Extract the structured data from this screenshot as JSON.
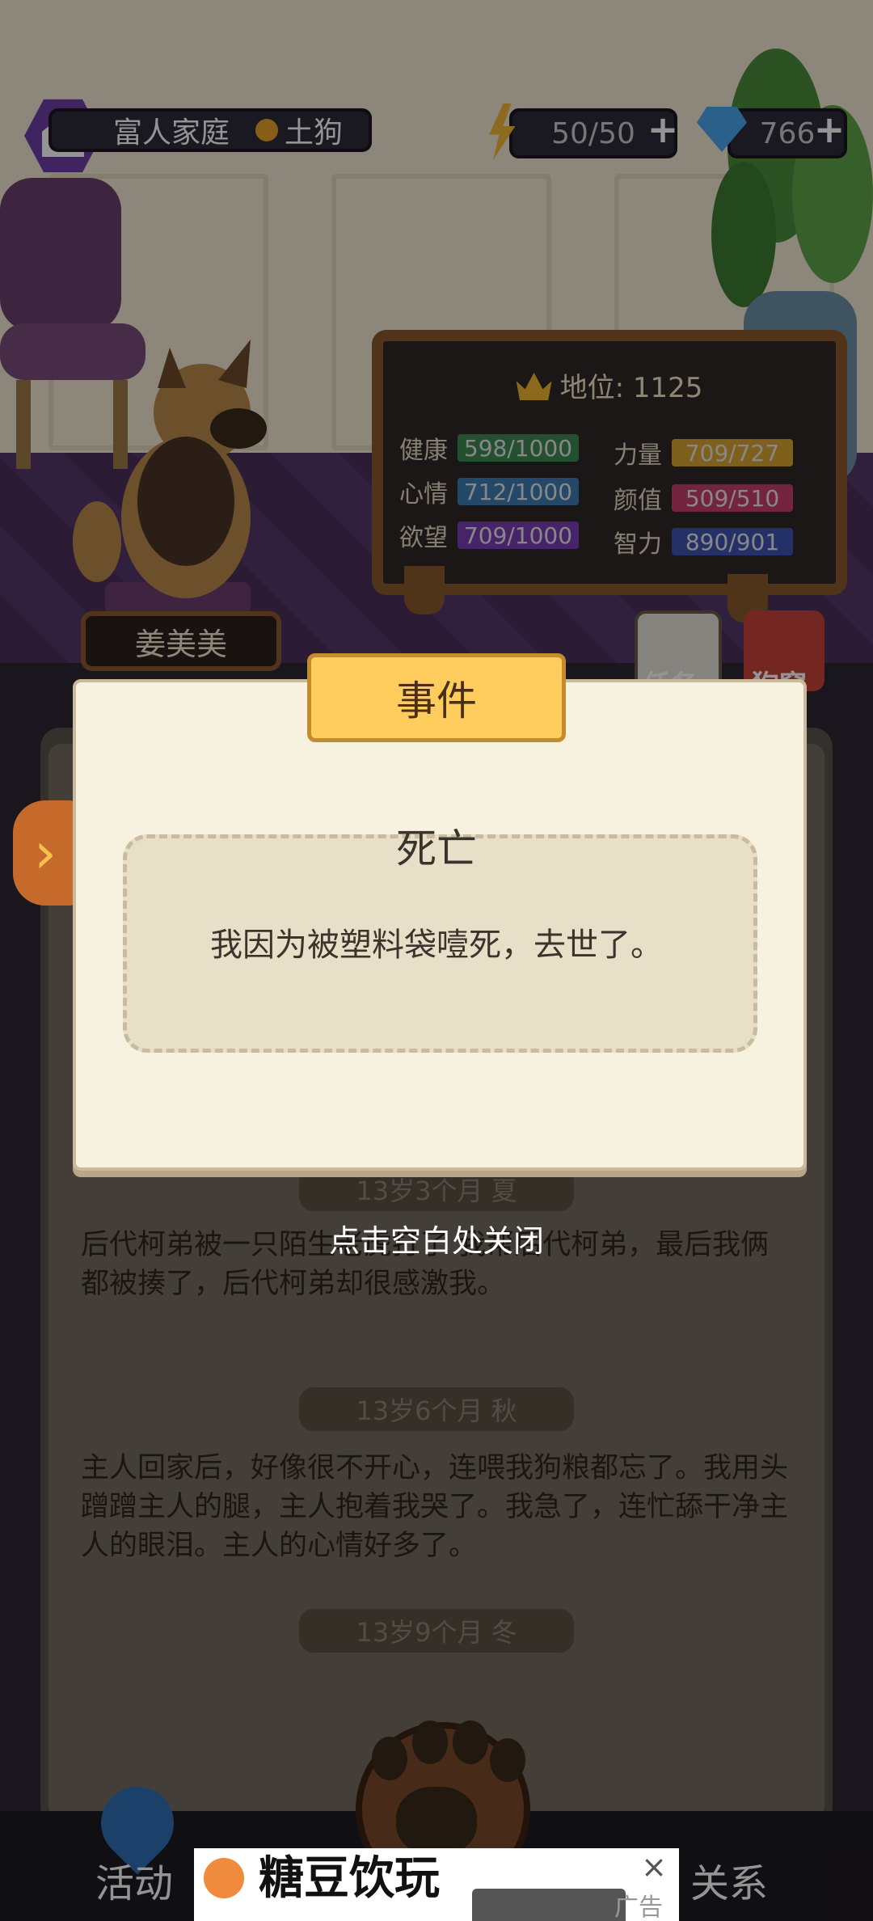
{
  "top_bar": {
    "family": "富人家庭",
    "breed": "土狗",
    "energy": "50/50",
    "diamonds": "766"
  },
  "dog": {
    "name": "姜美美"
  },
  "status_board": {
    "title": "地位: 1125",
    "stats": [
      {
        "label": "健康",
        "value": "598/1000",
        "color": "#3f8a57"
      },
      {
        "label": "力量",
        "value": "709/727",
        "color": "#d9a531"
      },
      {
        "label": "心情",
        "value": "712/1000",
        "color": "#3f7db1"
      },
      {
        "label": "颜值",
        "value": "509/510",
        "color": "#c83e6c"
      },
      {
        "label": "欲望",
        "value": "709/1000",
        "color": "#7b3fb5"
      },
      {
        "label": "智力",
        "value": "890/901",
        "color": "#3f55b5"
      }
    ]
  },
  "side_icons": {
    "tasks": "任务",
    "kennel": "狗窝"
  },
  "event_dialog": {
    "header": "事件",
    "title": "死亡",
    "body": "我因为被塑料袋噎死，去世了。",
    "close_hint": "点击空白处关闭"
  },
  "log": [
    {
      "season": "13岁3个月 夏",
      "text": "后代柯弟被一只陌生老虎打了\n我帮后代柯弟，最后我俩都被揍了，后代柯弟却很感激我。"
    },
    {
      "season": "13岁6个月 秋",
      "text": "主人回家后，好像很不开心，连喂我狗粮都忘了。我用头蹭蹭主人的腿，主人抱着我哭了。我急了，连忙舔干净主人的眼泪。主人的心情好多了。"
    },
    {
      "season": "13岁9个月 冬",
      "text": ""
    }
  ],
  "bottom_nav": {
    "activity": "活动",
    "relation": "关系"
  },
  "ad": {
    "title": "糖豆饮玩",
    "tag": "广告"
  }
}
